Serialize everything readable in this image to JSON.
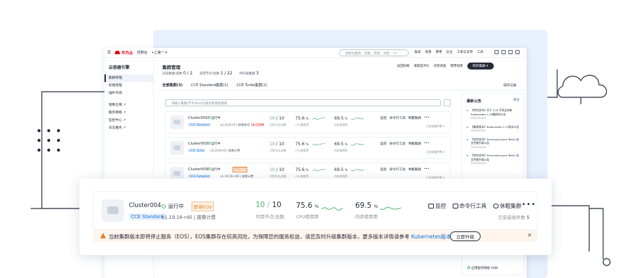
{
  "topbar": {
    "brand": "华为云",
    "console": "控制台",
    "region": "上海一",
    "search_placeholder": "搜索云服务、功能、资源、文档… (/)",
    "nav": [
      "备案",
      "资源",
      "费用",
      "企业",
      "工单与支持",
      "工具"
    ]
  },
  "sidebar": {
    "title": "云容器引擎",
    "items": [
      {
        "label": "集群管理",
        "active": true
      },
      {
        "label": "权限管理",
        "active": false
      },
      {
        "label": "插件市场",
        "active": false
      },
      {
        "label": "镜像仓库 ↗",
        "active": false
      },
      {
        "label": "服务网格 ↗",
        "active": false
      },
      {
        "label": "监控中心 ↗",
        "active": false
      },
      {
        "label": "日志服务 ↗",
        "active": false
      }
    ]
  },
  "header": {
    "title": "集群管理",
    "stat1_label": "异常集群/总数",
    "stat1_value": "0 / 2",
    "stat2_label": "异常节点/总数",
    "stat2_value": "1 / 22",
    "stat3_label": "待升级集群",
    "stat3_value": "3",
    "actions": [
      "返回旧版",
      "满意度评价",
      "问卷调查",
      "使用指南"
    ],
    "buy_label": "购买集群 ▾"
  },
  "tabs": [
    "全部集群(3)",
    "CCE Standard集群(1)",
    "CCE Turbo集群(1)"
  ],
  "oplog": "操作记录",
  "filter_placeholder": "请输入集群/节点/Pod/负载名称搜索搜索",
  "clusters": [
    {
      "name": "Cluster001",
      "status": "运行中",
      "eos": "",
      "tag": "CCE Standard",
      "version": "v1.23.6-r0 | 按需按月",
      "vsuffix": "1年后到期",
      "nodes": "10",
      "total": "10",
      "nodes_label": "可用节点/总数",
      "cpu": "75.6",
      "cpu_label": "CPU使用率",
      "mem": "69.5",
      "mem_label": "内存使用率",
      "actions": [
        "监控",
        "命令行工具",
        "唤醒集群"
      ],
      "due": "已安装插件数  5"
    },
    {
      "name": "Cluster002",
      "status": "运行中",
      "eos": "",
      "tag": "CCE Turbo",
      "version": "v1.23.6-r0 | 按需计费",
      "vsuffix": "",
      "nodes": "10",
      "total": "10",
      "nodes_label": "可用节点/总数",
      "cpu": "75.6",
      "cpu_label": "CPU使用率",
      "mem": "69.5",
      "mem_label": "内存使用率",
      "actions": [
        "监控",
        "命令行工具",
        "休眠集群"
      ],
      "due": "已安装插件数  5"
    },
    {
      "name": "Cluster003",
      "status": "运行中",
      "eos": "即将EOS",
      "tag": "CCE Autopilot",
      "version": "v1.19.16-r40 | 按需计费",
      "vsuffix": "",
      "nodes": "10",
      "total": "10",
      "nodes_label": "可用节点/总数",
      "cpu": "75.6",
      "cpu_label": "CPU使用率",
      "mem": "69.5",
      "mem_label": "内存使用率",
      "actions": [
        "监控",
        "命令行工具",
        "休眠集群"
      ],
      "due": "已安装插件数  5"
    }
  ],
  "news": {
    "title": "最新公告",
    "more": "更多",
    "items": [
      {
        "text": "【特性发布】关于 CCE 不再支持新Kubernetes 1.19集群的公告",
        "date": "2022/02/20"
      },
      {
        "text": "【集群版本】Kubernetes 1.17版本公告",
        "date": "2022/02/20"
      },
      {
        "text": "【特性发布】ServiceAccount Token 安全性能升级公告",
        "date": "2022/02/20"
      },
      {
        "text": "【特性发布】ServiceAccount Token 安全性能升级公告",
        "date": "2022/02/20"
      }
    ],
    "last": "应用服务网格 ASM"
  },
  "popup": {
    "name": "Cluster004",
    "status": "运行中",
    "eos": "即将EOS",
    "tag": "CCE Standard",
    "version": "v1.19.16-r40 | 按需计费",
    "nodes": "10",
    "total": "10",
    "nodes_label": "可用节点/总数",
    "cpu": "75.6",
    "cpu_label": "CPU使用率",
    "mem": "69.5",
    "mem_label": "内存使用率",
    "actions": [
      "监控",
      "命令行工具",
      "休眠集群"
    ],
    "addons_label": "已安装插件数",
    "addons": "5",
    "warning_text": "当前集群版本即将停止服务（EOS），EOS集群存在较高风险，为保障您的服务权益，请您及时升级集群版本，更多版本详情请参考",
    "warning_link": "Kubernetes版本策略",
    "upgrade_label": "立即升级"
  },
  "colors": {
    "accent": "#0c6fd6",
    "success": "#50b371",
    "warning": "#e37d29",
    "dark": "#252b3a"
  }
}
